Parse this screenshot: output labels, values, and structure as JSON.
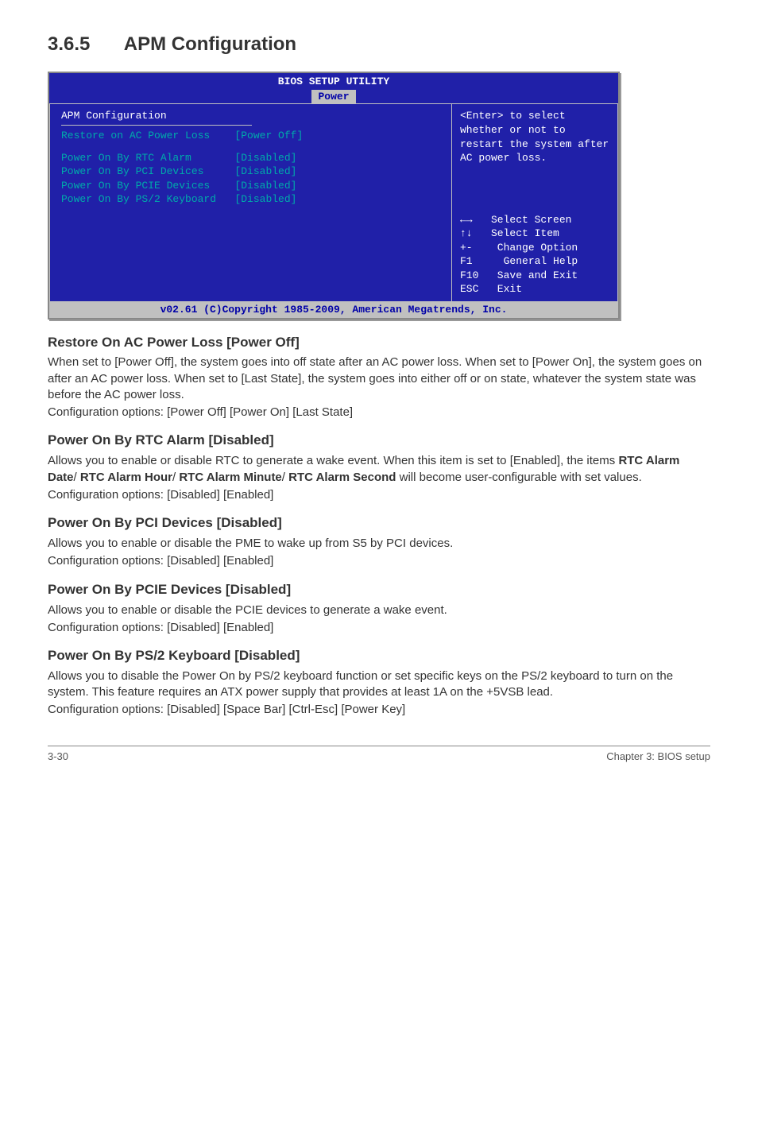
{
  "section": {
    "number": "3.6.5",
    "title": "APM Configuration"
  },
  "bios": {
    "header_title": "BIOS SETUP UTILITY",
    "tab": "Power",
    "cfg_title": "APM Configuration",
    "rows": [
      {
        "label": "Restore on AC Power Loss",
        "value": "[Power Off]"
      },
      {
        "label": "Power On By RTC Alarm",
        "value": "[Disabled]"
      },
      {
        "label": "Power On By PCI Devices",
        "value": "[Disabled]"
      },
      {
        "label": "Power On By PCIE Devices",
        "value": "[Disabled]"
      },
      {
        "label": "Power On By PS/2 Keyboard",
        "value": "[Disabled]"
      }
    ],
    "hint": "<Enter> to select whether or not to restart the system after AC power loss.",
    "keys": [
      {
        "sym": "←→",
        "desc": "Select Screen"
      },
      {
        "sym": "↑↓",
        "desc": "Select Item"
      },
      {
        "sym": "+-",
        "desc": " Change Option"
      },
      {
        "sym": "F1",
        "desc": "  General Help"
      },
      {
        "sym": "F10",
        "desc": " Save and Exit"
      },
      {
        "sym": "ESC",
        "desc": " Exit"
      }
    ],
    "footer": "v02.61 (C)Copyright 1985-2009, American Megatrends, Inc."
  },
  "subsections": [
    {
      "title": "Restore On AC Power Loss [Power Off]",
      "body": "When set to [Power Off], the system goes into off state after an AC power loss. When set to [Power On], the system goes on after an AC power loss. When set to [Last State], the system goes into either off or on state, whatever the system state was before the AC power loss.",
      "config": "Configuration options: [Power Off] [Power On] [Last State]"
    },
    {
      "title": "Power On By RTC Alarm [Disabled]",
      "body_html": "Allows you to enable or disable RTC to generate a wake event. When this item is set to [Enabled], the items <b>RTC Alarm Date</b>/ <b>RTC Alarm Hour</b>/ <b>RTC Alarm Minute</b>/ <b>RTC Alarm Second</b> will become user-configurable with set values.",
      "config": "Configuration options: [Disabled] [Enabled]"
    },
    {
      "title": "Power On By PCI Devices [Disabled]",
      "body": "Allows you to enable or disable the PME to wake up from S5 by PCI devices.",
      "config": "Configuration options: [Disabled] [Enabled]"
    },
    {
      "title": "Power On By PCIE Devices [Disabled]",
      "body": "Allows you to enable or disable the PCIE devices to generate a wake event.",
      "config": "Configuration options: [Disabled] [Enabled]"
    },
    {
      "title": "Power On By PS/2 Keyboard [Disabled]",
      "body": "Allows you to disable the Power On by PS/2 keyboard function or set specific keys on the PS/2 keyboard to turn on the system. This feature requires an ATX power supply that provides at least 1A on the +5VSB lead.",
      "config": "Configuration options: [Disabled] [Space Bar] [Ctrl-Esc] [Power Key]"
    }
  ],
  "footer": {
    "left": "3-30",
    "right": "Chapter 3: BIOS setup"
  }
}
